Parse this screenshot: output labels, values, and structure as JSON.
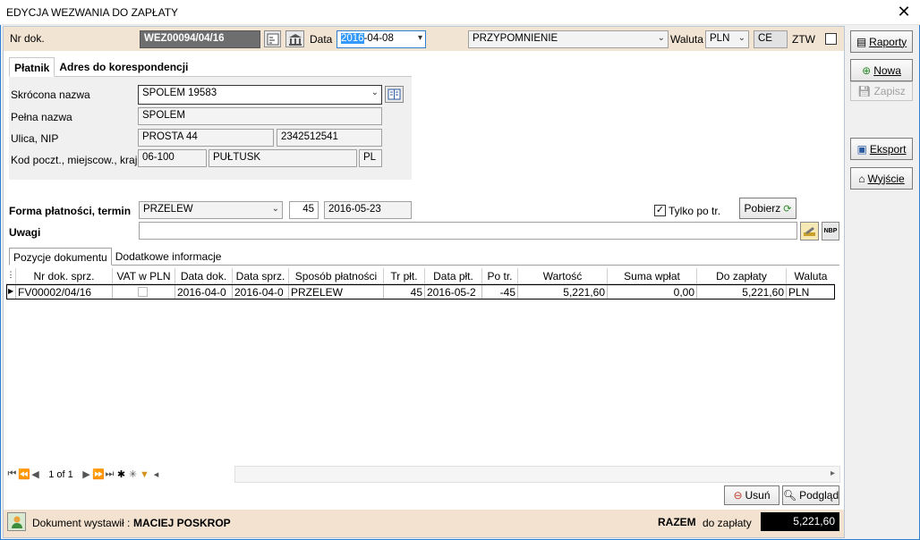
{
  "window": {
    "title": "EDYCJA WEZWANIA DO ZAPŁATY",
    "close_glyph": "✕"
  },
  "header": {
    "nr_dok_label": "Nr dok.",
    "nr_dok_value": "WEZ00094/04/16",
    "data_label": "Data",
    "data_value_selected": "2016",
    "data_value_rest": "-04-08",
    "type_value": "PRZYPOMNIENIE",
    "waluta_label": "Waluta",
    "waluta_value": "PLN",
    "ce_value": "CE",
    "ztw_label": "ZTW"
  },
  "tabs_top": [
    "Płatnik",
    "Adres do korespondencji"
  ],
  "platnik": {
    "skrocona_label": "Skrócona nazwa",
    "skrocona_value": "SPOLEM 19583",
    "pelna_label": "Pełna nazwa",
    "pelna_value": "SPOLEM",
    "ulica_label": "Ulica, NIP",
    "ulica_value": "PROSTA 44",
    "nip_value": "2342512541",
    "kod_label": "Kod poczt., miejscow., kraj",
    "kod_value": "06-100",
    "miejscowosc_value": "PUŁTUSK",
    "kraj_value": "PL"
  },
  "payment": {
    "forma_label": "Forma płatności, termin",
    "forma_value": "PRZELEW",
    "days_value": "45",
    "termin_value": "2016-05-23",
    "tylko_label": "Tylko po tr.",
    "pobierz_label": "Pobierz",
    "uwagi_label": "Uwagi",
    "nbp_label": "NBP"
  },
  "tabs_bottom": [
    "Pozycje dokumentu",
    "Dodatkowe informacje"
  ],
  "grid": {
    "columns": [
      "Nr dok. sprz.",
      "VAT w PLN",
      "Data dok.",
      "Data sprz.",
      "Sposób płatności",
      "Tr płt.",
      "Data płt.",
      "Po tr.",
      "Wartość",
      "Suma wpłat",
      "Do zapłaty",
      "Waluta"
    ],
    "rows": [
      [
        "FV00002/04/16",
        "",
        "2016-04-0",
        "2016-04-0",
        "PRZELEW",
        "45",
        "2016-05-2",
        "-45",
        "5,221,60",
        "0,00",
        "5,221,60",
        "PLN"
      ]
    ]
  },
  "navigator": {
    "page_text": "1 of 1"
  },
  "grid_buttons": {
    "usun": "Usuń",
    "podglad": "Podgląd"
  },
  "footer": {
    "wystawil_label": "Dokument wystawił :",
    "wystawil_value": "MACIEJ POSKROP",
    "razem_label": "RAZEM",
    "do_zaplaty_label": "do zapłaty",
    "total_value": "5,221,60"
  },
  "right_panel": {
    "raporty": "Raporty",
    "nowa": "Nowa",
    "zapisz": "Zapisz",
    "eksport": "Eksport",
    "wyjscie": "Wyjście"
  },
  "colors": {
    "accent": "#2c7fd1",
    "header_band": "#f1e4d3",
    "dark_field": "#6e6e6e"
  }
}
